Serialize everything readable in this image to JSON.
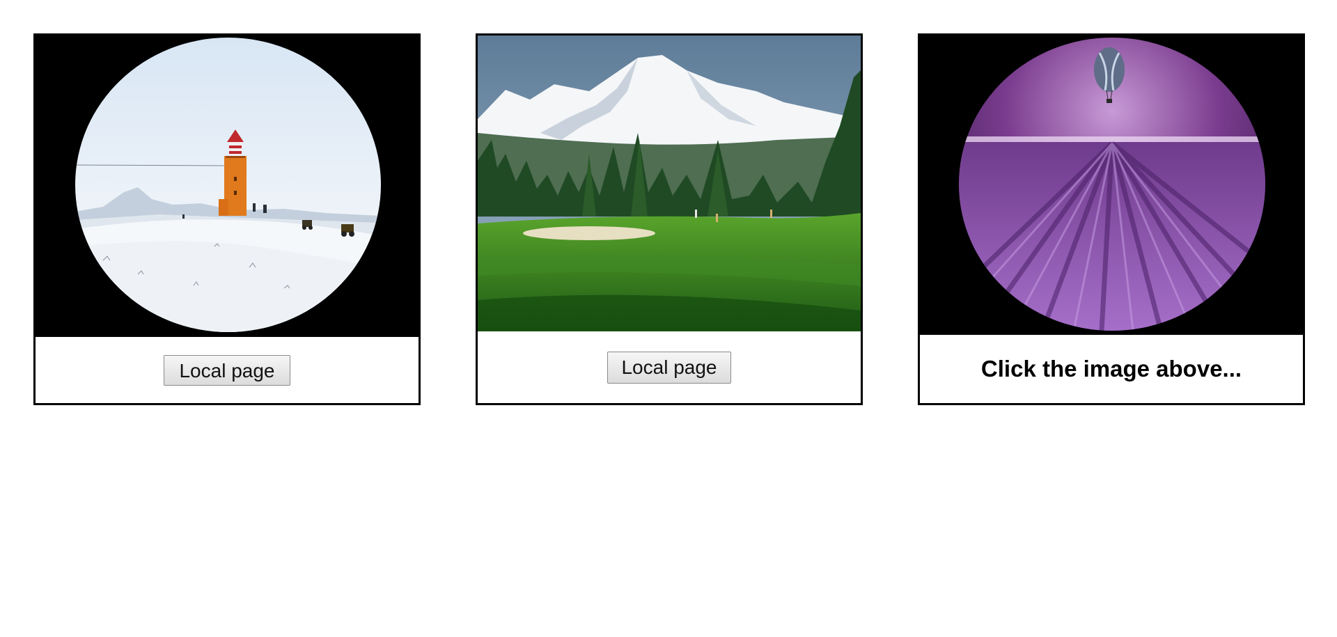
{
  "cards": [
    {
      "image": {
        "icon": "lighthouse-snow-image"
      },
      "button_label": "Local page"
    },
    {
      "image": {
        "icon": "mountain-golf-course-image"
      },
      "button_label": "Local page"
    },
    {
      "image": {
        "icon": "lavender-field-balloon-image"
      },
      "caption": "Click the image above..."
    }
  ]
}
